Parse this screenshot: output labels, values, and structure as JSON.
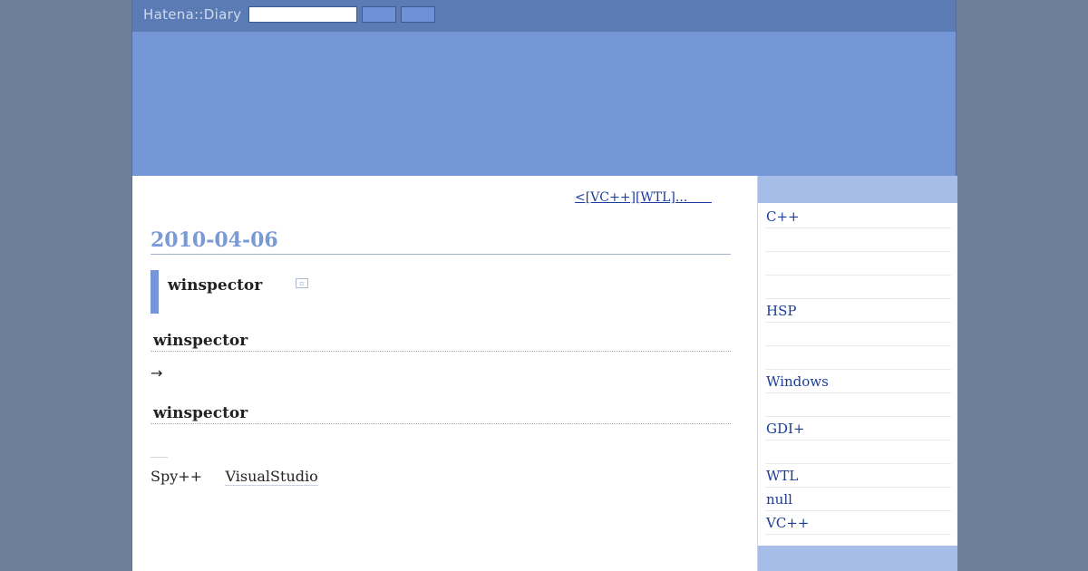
{
  "header": {
    "logo": "Hatena::Diary",
    "search_value": "",
    "button1_label": "",
    "button2_label": ""
  },
  "nav": {
    "prev_link": "<[VC++][WTL]...      "
  },
  "entry": {
    "date": "2010-04-06",
    "title": "winspector",
    "icon": "image-icon",
    "sections": [
      {
        "heading": "winspector"
      },
      {
        "heading": "winspector"
      }
    ],
    "arrow": "→",
    "para_prefix": "Spy++     ",
    "para_keyword": "VisualStudio"
  },
  "sidebar": {
    "categories": [
      "C++",
      "",
      "",
      "",
      "HSP",
      "",
      "",
      "Windows",
      "",
      "GDI+",
      "",
      "WTL",
      "null",
      "VC++"
    ]
  },
  "colors": {
    "topbar": "#5b7bb5",
    "banner": "#7596d7",
    "accent": "#7a9ad6",
    "sidebar_head": "#a6bde8",
    "link": "#1a3d99"
  }
}
